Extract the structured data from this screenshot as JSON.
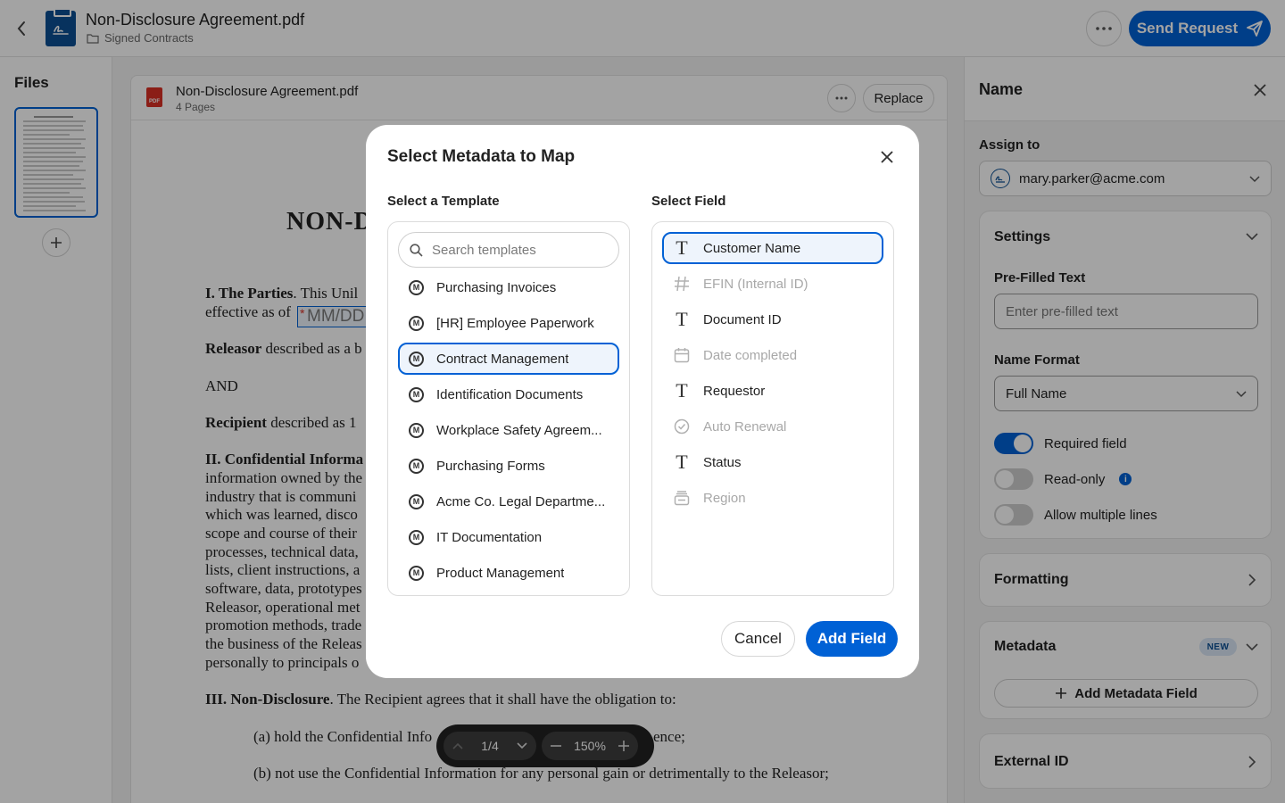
{
  "header": {
    "file_name": "Non-Disclosure Agreement.pdf",
    "folder": "Signed Contracts",
    "send_label": "Send Request"
  },
  "files": {
    "title": "Files"
  },
  "document": {
    "name": "Non-Disclosure Agreement.pdf",
    "pages": "4 Pages",
    "replace_label": "Replace",
    "heading": "NON-D",
    "date_placeholder": "MM/DD",
    "lines": [
      {
        "bold": "I. The Parties",
        "text": ". This Unil"
      },
      {
        "bold": "",
        "text": "effective as of"
      },
      {
        "bold": "Releasor",
        "text": " described as a b"
      },
      {
        "bold": "",
        "text": "AND"
      },
      {
        "bold": "Recipient",
        "text": " described as 1"
      },
      {
        "bold": "II. Confidential Informa",
        "text": ""
      },
      {
        "bold": "",
        "text": "information owned by the"
      },
      {
        "bold": "",
        "text": "industry that is communi"
      },
      {
        "bold": "",
        "text": "which was learned, disco"
      },
      {
        "bold": "",
        "text": "scope and course of their"
      },
      {
        "bold": "",
        "text": "processes, technical data,"
      },
      {
        "bold": "",
        "text": "lists, client instructions, a"
      },
      {
        "bold": "",
        "text": "software, data, prototypes"
      },
      {
        "bold": "",
        "text": "Releasor, operational met"
      },
      {
        "bold": "",
        "text": "promotion methods, trade"
      },
      {
        "bold": "",
        "text": "the business of the Releas"
      },
      {
        "bold": "",
        "text": "personally to principals o"
      },
      {
        "bold": "III. Non-Disclosure",
        "text": ". The Recipient agrees that it shall have the obligation to:"
      },
      {
        "bold": "",
        "text": "(a) hold the Confidential Info"
      },
      {
        "bold": "",
        "text": "ence;"
      },
      {
        "bold": "",
        "text": "(b) not use the Confidential Information for any personal gain or detrimentally to the Releasor;"
      }
    ],
    "page_indicator": "1/4",
    "zoom": "150%"
  },
  "properties": {
    "title": "Name",
    "assign_label": "Assign to",
    "assignee": "mary.parker@acme.com",
    "settings_title": "Settings",
    "prefilled_label": "Pre-Filled Text",
    "prefilled_placeholder": "Enter pre-filled text",
    "name_format_label": "Name Format",
    "name_format_value": "Full Name",
    "toggles": [
      {
        "label": "Required field",
        "on": true
      },
      {
        "label": "Read-only",
        "on": false
      },
      {
        "label": "Allow multiple lines",
        "on": false
      }
    ],
    "formatting_title": "Formatting",
    "metadata_title": "Metadata",
    "metadata_badge": "NEW",
    "add_metadata_label": "Add Metadata Field",
    "external_id_title": "External ID"
  },
  "modal": {
    "title": "Select Metadata to Map",
    "template_label": "Select a Template",
    "field_label": "Select Field",
    "search_placeholder": "Search templates",
    "templates": [
      {
        "label": "Purchasing Invoices",
        "selected": false
      },
      {
        "label": "[HR] Employee Paperwork",
        "selected": false
      },
      {
        "label": "Contract Management",
        "selected": true
      },
      {
        "label": "Identification Documents",
        "selected": false
      },
      {
        "label": "Workplace Safety Agreem...",
        "selected": false
      },
      {
        "label": "Purchasing Forms",
        "selected": false
      },
      {
        "label": "Acme Co. Legal Departme...",
        "selected": false
      },
      {
        "label": "IT Documentation",
        "selected": false
      },
      {
        "label": "Product Management",
        "selected": false
      }
    ],
    "fields": [
      {
        "label": "Customer Name",
        "icon": "text-type-icon",
        "enabled": true,
        "selected": true
      },
      {
        "label": "EFIN (Internal ID)",
        "icon": "number-hash-icon",
        "enabled": false,
        "selected": false
      },
      {
        "label": "Document ID",
        "icon": "text-type-icon",
        "enabled": true,
        "selected": false
      },
      {
        "label": "Date completed",
        "icon": "calendar-icon",
        "enabled": false,
        "selected": false
      },
      {
        "label": "Requestor",
        "icon": "text-type-icon",
        "enabled": true,
        "selected": false
      },
      {
        "label": "Auto Renewal",
        "icon": "checkmark-circle-icon",
        "enabled": false,
        "selected": false
      },
      {
        "label": "Status",
        "icon": "text-type-icon",
        "enabled": true,
        "selected": false
      },
      {
        "label": "Region",
        "icon": "dropdown-list-icon",
        "enabled": false,
        "selected": false
      }
    ],
    "cancel_label": "Cancel",
    "add_label": "Add Field"
  },
  "colors": {
    "accent": "#0061d5",
    "brand_dark": "#0b4f93",
    "pdf_red": "#d93025"
  }
}
